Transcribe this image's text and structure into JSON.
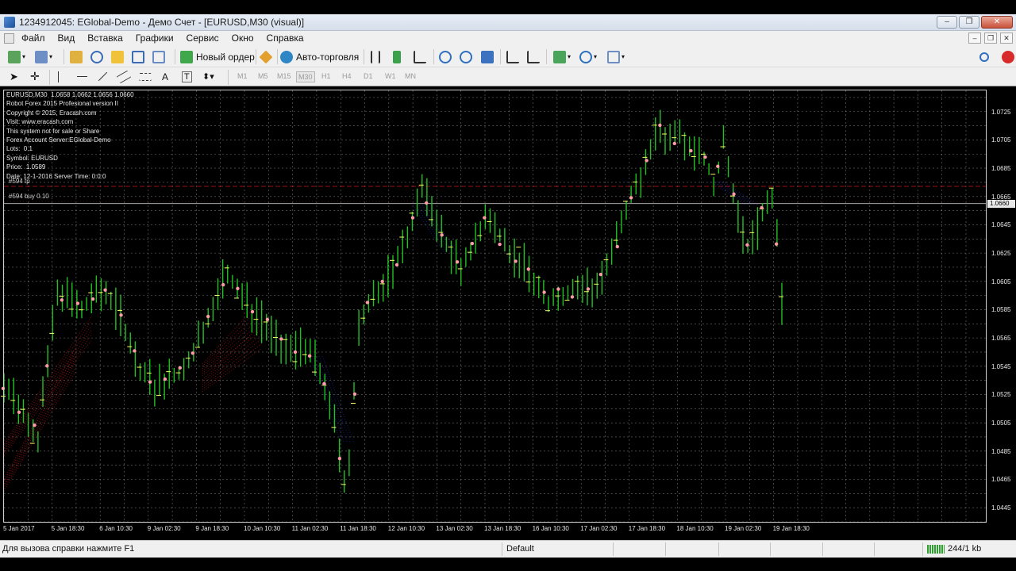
{
  "window": {
    "title": "1234912045: EGlobal-Demo - Демо Счет - [EURUSD,M30 (visual)]",
    "controls": [
      "–",
      "❐",
      "✕"
    ]
  },
  "menu": [
    "Файл",
    "Вид",
    "Вставка",
    "Графики",
    "Сервис",
    "Окно",
    "Справка"
  ],
  "toolbar": {
    "new_order": "Новый ордер",
    "auto_trading": "Авто-торговля",
    "timeframes": [
      "M1",
      "M5",
      "M15",
      "M30",
      "H1",
      "H4",
      "D1",
      "W1",
      "MN"
    ],
    "active_timeframe": "M30",
    "drawing_tools": [
      "A",
      "T"
    ]
  },
  "chart": {
    "header": "EURUSD,M30  1.0658 1.0662 1.0656 1.0660",
    "info_lines": [
      "Robot Forex 2015 Profesional version II",
      "Copyright © 2015, Eracash.com",
      "Visit: www.eracash.com",
      "This system not for sale or Share",
      "Forex Account Server:EGlobal-Demo",
      "Lots:  0.1",
      "Symbol: EURUSD",
      "Price:  1.0589",
      "Date: 12-1-2016 Server Time: 0:0:0"
    ],
    "order_tp": "#594 tp",
    "order_buy": "#594 buy 0.10",
    "current_price": "1.0660",
    "colors": {
      "background": "#000000",
      "grid": "#c8c8c8",
      "candle": "#22c022",
      "marker": "#ff9aa8",
      "tick": "#ffff66",
      "sell_zone": "#cc1b1b",
      "buy_zone": "#1d2ea8"
    }
  },
  "chart_data": {
    "type": "line",
    "title": "EURUSD,M30",
    "ylim": [
      1.0435,
      1.074
    ],
    "y_ticks": [
      "1.0725",
      "1.0705",
      "1.0685",
      "1.0665",
      "1.0645",
      "1.0625",
      "1.0605",
      "1.0585",
      "1.0565",
      "1.0545",
      "1.0525",
      "1.0505",
      "1.0485",
      "1.0465",
      "1.0445"
    ],
    "x_ticks": [
      "5 Jan 2017",
      "5 Jan 18:30",
      "6 Jan 10:30",
      "9 Jan 02:30",
      "9 Jan 18:30",
      "10 Jan 10:30",
      "11 Jan 02:30",
      "11 Jan 18:30",
      "12 Jan 10:30",
      "13 Jan 02:30",
      "13 Jan 18:30",
      "16 Jan 10:30",
      "17 Jan 02:30",
      "17 Jan 18:30",
      "18 Jan 10:30",
      "19 Jan 02:30",
      "19 Jan 18:30"
    ],
    "series": [
      {
        "x": [
          0,
          3,
          6,
          8,
          10,
          13,
          16,
          19,
          22,
          25,
          28,
          32,
          36,
          39,
          42,
          46,
          50,
          53,
          56,
          60,
          64,
          67,
          70,
          73,
          76,
          79,
          82,
          85,
          88,
          91,
          94,
          97,
          100,
          103,
          106,
          109,
          112,
          115,
          118,
          121,
          124,
          127,
          130,
          133,
          137,
          141,
          145,
          149,
          153,
          156,
          159,
          162,
          165,
          168,
          170,
          172,
          174,
          176,
          178,
          180,
          182,
          184,
          186
        ],
        "values": [
          1.053,
          1.052,
          1.0505,
          1.049,
          1.054,
          1.06,
          1.059,
          1.0585,
          1.06,
          1.0595,
          1.058,
          1.0545,
          1.053,
          1.0535,
          1.054,
          1.056,
          1.059,
          1.061,
          1.06,
          1.058,
          1.057,
          1.056,
          1.0555,
          1.056,
          1.0535,
          1.0505,
          1.0455,
          1.058,
          1.059,
          1.0605,
          1.062,
          1.064,
          1.067,
          1.065,
          1.063,
          1.0615,
          1.063,
          1.065,
          1.064,
          1.0625,
          1.062,
          1.0605,
          1.059,
          1.0595,
          1.06,
          1.06,
          1.062,
          1.066,
          1.068,
          1.0715,
          1.0705,
          1.071,
          1.0695,
          1.069,
          1.067,
          1.0705,
          1.067,
          1.064,
          1.063,
          1.064,
          1.066,
          1.0665,
          1.059
        ]
      }
    ]
  },
  "status": {
    "help": "Для вызова справки нажмите F1",
    "profile": "Default",
    "traffic": "244/1 kb"
  }
}
